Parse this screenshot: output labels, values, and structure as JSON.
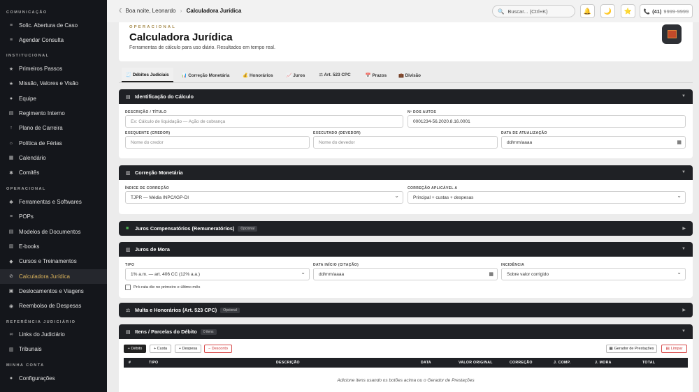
{
  "sidebar": {
    "sections": [
      {
        "title": "COMUNICAÇÃO",
        "items": [
          {
            "label": "Solic. Abertura de Caso",
            "icon": "list-icon",
            "glyph": "≡"
          },
          {
            "label": "Agendar Consulta",
            "icon": "list-icon",
            "glyph": "≡"
          }
        ]
      },
      {
        "title": "INSTITUCIONAL",
        "items": [
          {
            "label": "Primeiros Passos",
            "icon": "star-icon",
            "glyph": "★"
          },
          {
            "label": "Missão, Valores e Visão",
            "icon": "star-icon",
            "glyph": "★"
          },
          {
            "label": "Equipe",
            "icon": "users-icon",
            "glyph": "●"
          },
          {
            "label": "Regimento Interno",
            "icon": "document-icon",
            "glyph": "▤"
          },
          {
            "label": "Plano de Carreira",
            "icon": "arrow-up-icon",
            "glyph": "↑"
          },
          {
            "label": "Política de Férias",
            "icon": "sun-icon",
            "glyph": "☼"
          },
          {
            "label": "Calendário",
            "icon": "calendar-icon",
            "glyph": "▦"
          },
          {
            "label": "Comitês",
            "icon": "gear-icon",
            "glyph": "✱"
          }
        ]
      },
      {
        "title": "OPERACIONAL",
        "items": [
          {
            "label": "Ferramentas e Softwares",
            "icon": "gear-icon",
            "glyph": "✱"
          },
          {
            "label": "POPs",
            "icon": "list-icon",
            "glyph": "≡"
          },
          {
            "label": "Modelos de Documentos",
            "icon": "document-icon",
            "glyph": "▤"
          },
          {
            "label": "E-books",
            "icon": "book-icon",
            "glyph": "▥"
          },
          {
            "label": "Cursos e Treinamentos",
            "icon": "graduation-icon",
            "glyph": "◆"
          },
          {
            "label": "Calculadora Jurídica",
            "icon": "calculator-icon",
            "glyph": "⊘",
            "active": true
          },
          {
            "label": "Deslocamentos e Viagens",
            "icon": "car-icon",
            "glyph": "▣"
          },
          {
            "label": "Reembolso de Despesas",
            "icon": "money-icon",
            "glyph": "◉"
          }
        ]
      },
      {
        "title": "REFERÊNCIA JUDICIÁRIO",
        "items": [
          {
            "label": "Links do Judiciário",
            "icon": "link-icon",
            "glyph": "∞"
          },
          {
            "label": "Tribunais",
            "icon": "building-icon",
            "glyph": "▥"
          }
        ]
      },
      {
        "title": "MINHA CONTA",
        "items": [
          {
            "label": "Configurações",
            "icon": "user-icon",
            "glyph": "●"
          }
        ]
      }
    ]
  },
  "topbar": {
    "greeting": "Boa noite, Leonardo",
    "breadcrumb_current": "Calculadora Jurídica",
    "search_placeholder": "Buscar... (Ctrl+K)",
    "phone_code": "(41)",
    "phone_number": "9999-9999"
  },
  "header": {
    "eyebrow": "OPERACIONAL",
    "title": "Calculadora Jurídica",
    "subtitle": "Ferramentas de cálculo para uso diário. Resultados em tempo real."
  },
  "tabs": [
    {
      "label": "🧾 Débitos Judiciais",
      "active": true
    },
    {
      "label": "📊 Correção Monetária"
    },
    {
      "label": "💰 Honorários"
    },
    {
      "label": "📈 Juros"
    },
    {
      "label": "⚖ Art. 523 CPC"
    },
    {
      "label": "📅 Prazos"
    },
    {
      "label": "💼 Divisão"
    }
  ],
  "identificacao": {
    "title": "Identificação do Cálculo",
    "descricao_label": "DESCRIÇÃO / TÍTULO",
    "descricao_placeholder": "Ex: Cálculo de liquidação — Ação de cobrança",
    "autos_label": "Nº DOS AUTOS",
    "autos_value": "0001234-56.2020.8.16.0001",
    "exequente_label": "EXEQUENTE (CREDOR)",
    "exequente_placeholder": "Nome do credor",
    "executado_label": "EXECUTADO (DEVEDOR)",
    "executado_placeholder": "Nome do devedor",
    "data_label": "DATA DE ATUALIZAÇÃO",
    "data_value": "dd/mm/aaaa"
  },
  "correcao": {
    "title": "Correção Monetária",
    "indice_label": "ÍNDICE DE CORREÇÃO",
    "indice_value": "TJPR — Média INPC/IGP-DI",
    "aplicavel_label": "CORREÇÃO APLICÁVEL A",
    "aplicavel_value": "Principal + custas + despesas"
  },
  "juros_comp": {
    "title": "Juros Compensatórios (Remuneratórios)",
    "badge": "Opcional"
  },
  "juros_mora": {
    "title": "Juros de Mora",
    "tipo_label": "TIPO",
    "tipo_value": "1% a.m. — art. 406 CC (12% a.a.)",
    "data_label": "DATA INÍCIO (CITAÇÃO)",
    "data_value": "dd/mm/aaaa",
    "incidencia_label": "INCIDÊNCIA",
    "incidencia_value": "Sobre valor corrigido",
    "prorata_label": "Pró-rata die no primeiro e último mês"
  },
  "multa": {
    "title": "Multa e Honorários (Art. 523 CPC)",
    "badge": "Opcional"
  },
  "itens": {
    "title": "Itens / Parcelas do Débito",
    "badge": "0 itens",
    "btn_debito": "+ Débito",
    "btn_custa": "+ Custa",
    "btn_despesa": "+ Despesa",
    "btn_desconto": "− Desconto",
    "btn_gerador": "Gerador de Prestações",
    "btn_limpar": "Limpar",
    "columns": [
      "#",
      "TIPO",
      "DESCRIÇÃO",
      "DATA",
      "VALOR ORIGINAL",
      "CORREÇÃO",
      "J. COMP.",
      "J. MORA",
      "TOTAL"
    ],
    "empty_text": "Adicione itens usando os botões acima ou o Gerador de Prestações"
  }
}
